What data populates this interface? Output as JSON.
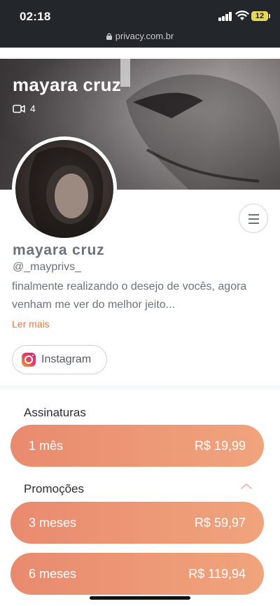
{
  "status_bar": {
    "time": "02:18",
    "battery": "12",
    "url": "privacy.com.br"
  },
  "cover": {
    "title": "mayara cruz",
    "video_count": "4"
  },
  "profile": {
    "name": "mayara cruz",
    "handle": "@_mayprivs_",
    "bio": "finalmente realizando o desejo de vocês, agora venham me ver do melhor jeito...",
    "read_more": "Ler mais",
    "instagram_label": "Instagram"
  },
  "subscriptions": {
    "title": "Assinaturas",
    "plans": [
      {
        "label": "1 mês",
        "price": "R$ 19,99"
      }
    ]
  },
  "promotions": {
    "title": "Promoções",
    "plans": [
      {
        "label": "3 meses",
        "price": "R$ 59,97"
      },
      {
        "label": "6 meses",
        "price": "R$ 119,94"
      }
    ]
  },
  "colors": {
    "accent": "#e8763f",
    "plan_gradient_start": "#e98a6f",
    "plan_gradient_end": "#f0a47c",
    "status_bar_bg": "#23262b"
  },
  "icons": [
    "lock-icon",
    "signal-icon",
    "wifi-icon",
    "battery-icon",
    "video-icon",
    "menu-icon",
    "instagram-icon",
    "chevron-up-icon"
  ]
}
